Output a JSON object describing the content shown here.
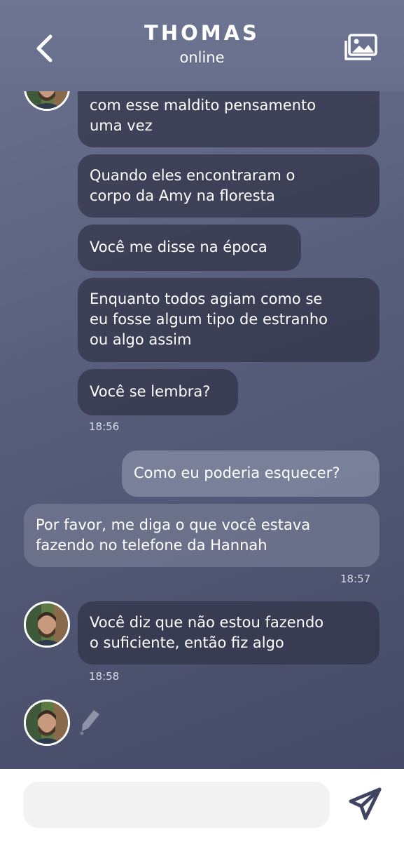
{
  "header": {
    "contact_name": "THOMAS",
    "status": "online",
    "back_icon": "chevron-left-icon",
    "gallery_icon": "gallery-icon"
  },
  "messages": [
    {
      "text_lines": [
        "com esse maldito pensamento",
        "uma vez"
      ]
    },
    {
      "text_lines": [
        "Quando eles encontraram o",
        "corpo da Amy na floresta"
      ]
    },
    {
      "text_lines": [
        "Você me disse na época"
      ]
    },
    {
      "text_lines": [
        "Enquanto todos agiam como se",
        "eu fosse algum tipo de estranho",
        "ou algo assim"
      ]
    },
    {
      "text_lines": [
        "Você se lembra?"
      ]
    },
    {
      "time": "18:56"
    },
    {
      "text_lines": [
        "Como eu poderia esquecer?"
      ]
    },
    {
      "text_lines": [
        "Por favor, me diga o que você estava",
        "fazendo no telefone da Hannah"
      ]
    },
    {
      "time": "18:57"
    },
    {
      "text_lines": [
        "Você diz que não estou fazendo",
        "o suficiente, então fiz algo"
      ]
    },
    {
      "time": "18:58"
    }
  ],
  "composer": {
    "placeholder": "",
    "send_icon": "send-icon"
  },
  "colors": {
    "background_top": "#6b7391",
    "background_bottom": "#454a66",
    "bubble_incoming": "#3a3d55",
    "bubble_outgoing": "#878da6",
    "text": "#ffffff",
    "icon_dark": "#3f4463"
  }
}
